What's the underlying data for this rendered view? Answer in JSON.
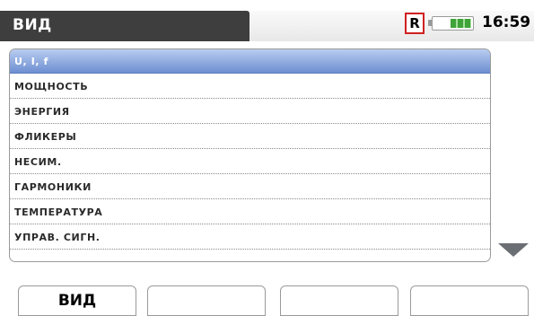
{
  "header": {
    "title": "ВИД",
    "record_indicator": "R",
    "clock": "16:59",
    "battery_level": 0.55
  },
  "menu": {
    "items": [
      {
        "label": "U, I, f",
        "selected": true
      },
      {
        "label": "МОЩНОСТЬ",
        "selected": false
      },
      {
        "label": "ЭНЕРГИЯ",
        "selected": false
      },
      {
        "label": "ФЛИКЕРЫ",
        "selected": false
      },
      {
        "label": "НЕСИМ.",
        "selected": false
      },
      {
        "label": "ГАРМОНИКИ",
        "selected": false
      },
      {
        "label": "ТЕМПЕРАТУРА",
        "selected": false
      },
      {
        "label": "УПРАВ. СИГН.",
        "selected": false
      }
    ],
    "scroll_icon": "down-triangle-icon"
  },
  "function_keys": [
    {
      "label": "ВИД"
    },
    {
      "label": ""
    },
    {
      "label": ""
    },
    {
      "label": ""
    }
  ],
  "colors": {
    "titlebar": "#3e3e3e",
    "selection": "#6d8ed1",
    "record_border": "#d02020",
    "battery_green": "#3fa33a"
  }
}
